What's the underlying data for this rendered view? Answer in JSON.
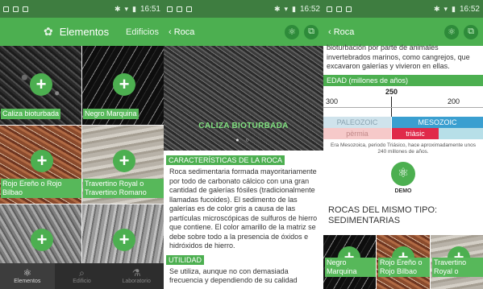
{
  "screen1": {
    "status": {
      "time": "16:51"
    },
    "appbar": {
      "title": "Elementos",
      "tab2": "Edificios"
    },
    "tiles": [
      {
        "label": "Caliza bioturbada"
      },
      {
        "label": "Negro Marquina"
      },
      {
        "label": "Rojo Ereño o Rojo Bilbao"
      },
      {
        "label": "Travertino Royal o Travertino Romano"
      },
      {
        "label": ""
      },
      {
        "label": ""
      }
    ],
    "nav": [
      {
        "label": "Elementos",
        "icon": "elements-icon"
      },
      {
        "label": "Edificio",
        "icon": "search-icon"
      },
      {
        "label": "Laboratorio",
        "icon": "flask-icon"
      }
    ]
  },
  "screen2": {
    "status": {
      "time": "16:52"
    },
    "appbar": {
      "back": "‹ Roca"
    },
    "hero_caption": "CALIZA BIOTURBADA",
    "hero_dots": "● ○",
    "section1": {
      "heading": "CARACTERÍSTICAS DE LA ROCA",
      "text": "Roca sedimentaria formada mayoritariamente por todo de carbonato cálcico con una gran cantidad de galerías fósiles (tradicionalmente llamadas fucoides). El sedimento de las galerías es de color gris a causa de las partículas microscópicas de sulfuros de hierro que contiene. El color amarillo de la matriz se debe sobre todo a la presencia de óxidos e hidróxidos de hierro."
    },
    "section2": {
      "heading": "UTILIDAD",
      "text": "Se utiliza, aunque no con demasiada frecuencia y dependiendo de su calidad"
    }
  },
  "screen3": {
    "status": {
      "time": "16:52"
    },
    "appbar": {
      "back": "‹ Roca"
    },
    "intro_text": "bioturbación por parte de animales invertebrados marinos, como cangrejos, que excavaron galerías y vivieron en ellas.",
    "edad": {
      "heading": "EDAD (millones de años)",
      "tick_300": "300",
      "tick_250": "250",
      "tick_200": "200",
      "era_paleozoic": "PALEOZOIC",
      "era_mesozoic": "MESOZOIC",
      "period_permia": "pèrmia",
      "period_triasic": "triàsic"
    },
    "era_note": "Era Mesozoica, periodo Triásico, hace aproximadamente unos 240 millones de años.",
    "demo_label": "DEMO",
    "rocas_title": "ROCAS DEL MISMO TIPO: SEDIMENTARIAS",
    "related": [
      {
        "label": "Negro Marquina"
      },
      {
        "label": "Rojo Ereño o Rojo Bilbao"
      },
      {
        "label": "Travertino Royal o"
      }
    ]
  },
  "colors": {
    "primary": "#4caf50",
    "statusbar": "#3e7d40",
    "mesozoic": "#3a9fd0",
    "paleozoic": "#cfe3ec",
    "triasic": "#e0294a",
    "permia": "#f6c9c9"
  }
}
